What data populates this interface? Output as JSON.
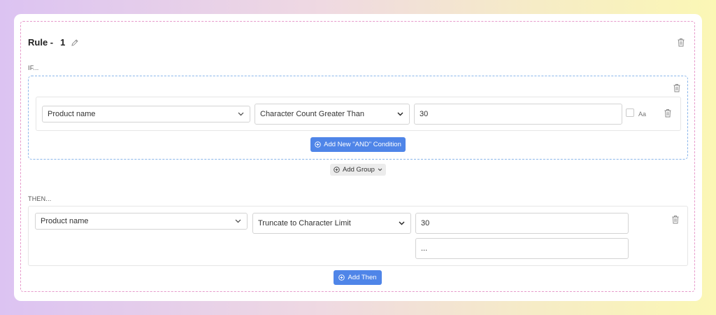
{
  "rule": {
    "title_prefix": "Rule -",
    "number": "1"
  },
  "if_section": {
    "label": "IF...",
    "condition": {
      "field": "Product name",
      "operator": "Character Count Greater Than",
      "value": "30",
      "case_label": "Aa"
    },
    "add_and_label": "Add New \"AND\" Condition"
  },
  "add_group_label": "Add Group",
  "then_section": {
    "label": "THEN...",
    "action": {
      "field": "Product name",
      "operation": "Truncate to Character Limit",
      "limit_value": "30",
      "suffix_value": "..."
    },
    "add_then_label": "Add Then"
  },
  "colors": {
    "primary": "#4f85e8",
    "rule_border": "#e79acb",
    "group_border": "#8ab6ea"
  }
}
